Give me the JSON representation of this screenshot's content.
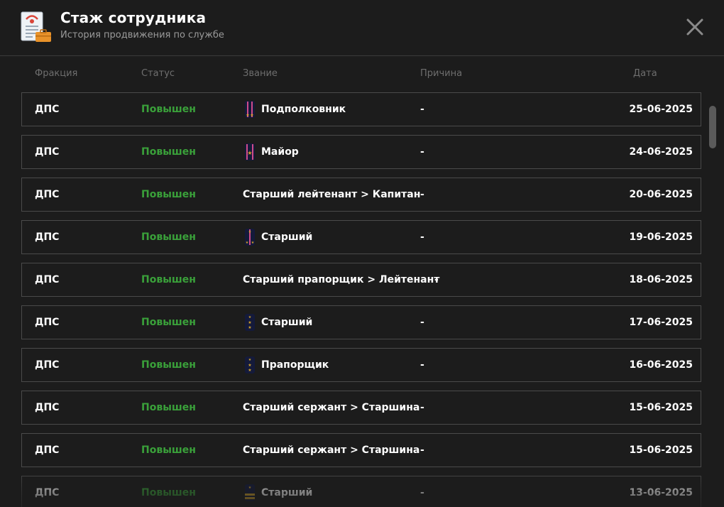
{
  "header": {
    "title": "Стаж сотрудника",
    "subtitle": "История продвижения по службе"
  },
  "columns": {
    "fraction": "Фракция",
    "status": "Статус",
    "rank": "Звание",
    "reason": "Причина",
    "date": "Дата"
  },
  "rows": [
    {
      "fraction": "ДПС",
      "status": "Повышен",
      "rank": "Подполковник",
      "rank_icon": "lt-colonel-epaulette-icon",
      "reason": "-",
      "date": "25-06-2025"
    },
    {
      "fraction": "ДПС",
      "status": "Повышен",
      "rank": "Майор",
      "rank_icon": "major-epaulette-icon",
      "reason": "-",
      "date": "24-06-2025"
    },
    {
      "fraction": "ДПС",
      "status": "Повышен",
      "rank": "Старший лейтенант > Капитан",
      "rank_icon": "",
      "reason": "-",
      "date": "20-06-2025"
    },
    {
      "fraction": "ДПС",
      "status": "Повышен",
      "rank": "Старший",
      "rank_icon": "senior-lieutenant-epaulette-icon",
      "reason": "-",
      "date": "19-06-2025"
    },
    {
      "fraction": "ДПС",
      "status": "Повышен",
      "rank": "Старший прапорщик > Лейтенант",
      "rank_icon": "",
      "reason": "-",
      "date": "18-06-2025"
    },
    {
      "fraction": "ДПС",
      "status": "Повышен",
      "rank": "Старший",
      "rank_icon": "senior-warrant-epaulette-icon",
      "reason": "-",
      "date": "17-06-2025"
    },
    {
      "fraction": "ДПС",
      "status": "Повышен",
      "rank": "Прапорщик",
      "rank_icon": "warrant-epaulette-icon",
      "reason": "-",
      "date": "16-06-2025"
    },
    {
      "fraction": "ДПС",
      "status": "Повышен",
      "rank": "Старший сержант > Старшина",
      "rank_icon": "",
      "reason": "-",
      "date": "15-06-2025"
    },
    {
      "fraction": "ДПС",
      "status": "Повышен",
      "rank": "Старший сержант > Старшина",
      "rank_icon": "",
      "reason": "-",
      "date": "15-06-2025"
    },
    {
      "fraction": "ДПС",
      "status": "Повышен",
      "rank": "Старший",
      "rank_icon": "senior-sergeant-epaulette-icon",
      "reason": "-",
      "date": "13-06-2025"
    }
  ],
  "colors": {
    "background": "#1c1c1c",
    "row_border": "#4a4a4a",
    "status_green": "#3aa13a",
    "header_text": "#6e6e6e",
    "epaulette_dark": "#141a3a",
    "stripe_pink": "#d04a8a",
    "star_gold": "#d4a42a"
  }
}
